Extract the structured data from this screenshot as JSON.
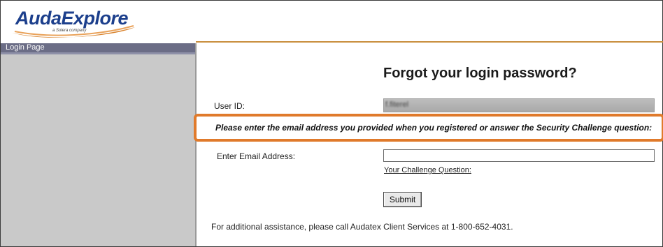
{
  "header": {
    "logo_text": "AudaExplore",
    "logo_sub": "a Solera company"
  },
  "sidebar": {
    "tab_label": "Login Page"
  },
  "main": {
    "title": "Forgot your login password?",
    "user_id_label": "User ID:",
    "user_id_value": "f.fiterel",
    "instruction": "Please enter the email address you provided when you registered or answer the Security Challenge question:",
    "email_label": "Enter Email Address:",
    "email_value": "",
    "challenge_link": "Your Challenge Question:",
    "submit_label": "Submit",
    "assistance": "For additional assistance, please call Audatex Client Services at 1-800-652-4031."
  },
  "colors": {
    "highlight": "#e07a2b",
    "sidebar_tab": "#6b6d86",
    "sidebar_bg": "#c9c9c9",
    "logo_blue": "#1c3f8c",
    "logo_orange": "#d9822b"
  }
}
